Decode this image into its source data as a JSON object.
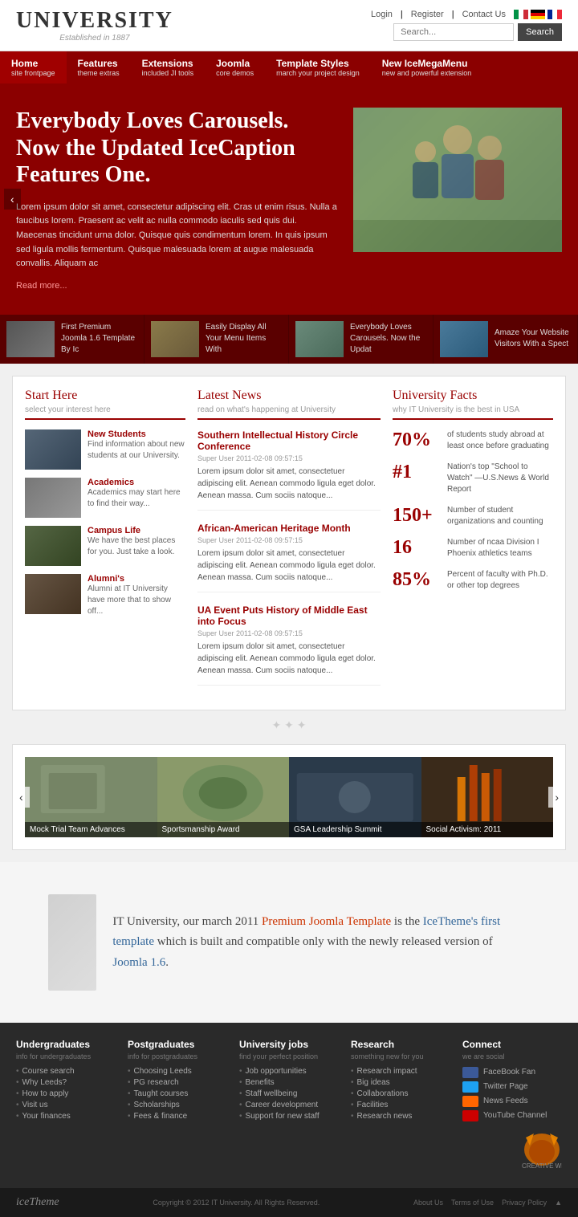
{
  "header": {
    "logo_title": "UNIVERSITY",
    "logo_sub": "Established in 1887",
    "links": [
      "Login",
      "Register",
      "Contact Us"
    ],
    "search_placeholder": "Search...",
    "search_btn": "Search"
  },
  "nav": {
    "items": [
      {
        "label": "Home",
        "sub": "site frontpage",
        "active": true
      },
      {
        "label": "Features",
        "sub": "theme extras",
        "active": false
      },
      {
        "label": "Extensions",
        "sub": "included JI tools",
        "active": false
      },
      {
        "label": "Joomla",
        "sub": "core demos",
        "active": false
      },
      {
        "label": "Template Styles",
        "sub": "march your project design",
        "active": false
      },
      {
        "label": "New IceMegaMenu",
        "sub": "new and powerful extension",
        "active": false
      }
    ]
  },
  "hero": {
    "title": "Everybody Loves Carousels. Now the Updated IceCaption Features One.",
    "body": "Lorem ipsum dolor sit amet, consectetur adipiscing elit. Cras ut enim risus. Nulla a faucibus lorem. Praesent ac velit ac nulla commodo iaculis sed quis dui. Maecenas tincidunt urna dolor. Quisque quis condimentum lorem. In quis ipsum sed ligula mollis fermentum. Quisque malesuada lorem at augue malesuada convallis. Aliquam ac",
    "read_more": "Read more..."
  },
  "carousel_thumbs": [
    {
      "text": "First Premium Joomla 1.6 Template By Ic"
    },
    {
      "text": "Easily Display All Your Menu Items With"
    },
    {
      "text": "Everybody Loves Carousels. Now the Updat"
    },
    {
      "text": "Amaze Your Website Visitors With a Spect"
    }
  ],
  "start_here": {
    "title": "Start Here",
    "subtitle": "select your interest here",
    "items": [
      {
        "label": "New Students",
        "desc": "Find information about new students at our University."
      },
      {
        "label": "Academics",
        "desc": "Academics may start here to find their way..."
      },
      {
        "label": "Campus Life",
        "desc": "We have the best places for you. Just take a look."
      },
      {
        "label": "Alumni's",
        "desc": "Alumni at IT University have more that to show off..."
      }
    ]
  },
  "latest_news": {
    "title": "Latest News",
    "subtitle": "read on what's happening at University",
    "items": [
      {
        "title": "Southern Intellectual History Circle Conference",
        "meta": "Super User    2011-02-08 09:57:15",
        "body": "Lorem ipsum dolor sit amet, consectetuer adipiscing elit. Aenean commodo ligula eget dolor. Aenean massa. Cum sociis natoque..."
      },
      {
        "title": "African-American Heritage Month",
        "meta": "Super User    2011-02-08 09:57:15",
        "body": "Lorem ipsum dolor sit amet, consectetuer adipiscing elit. Aenean commodo ligula eget dolor. Aenean massa. Cum sociis natoque..."
      },
      {
        "title": "UA Event Puts History of Middle East into Focus",
        "meta": "Super User    2011-02-08 09:57:15",
        "body": "Lorem ipsum dolor sit amet, consectetuer adipiscing elit. Aenean commodo ligula eget dolor. Aenean massa. Cum sociis natoque..."
      }
    ]
  },
  "university_facts": {
    "title": "University Facts",
    "subtitle": "why IT University is the best in USA",
    "items": [
      {
        "number": "70%",
        "text": "of students study abroad at least once before graduating"
      },
      {
        "number": "#1",
        "text": "Nation's top \"School to Watch\" —U.S.News & World Report"
      },
      {
        "number": "150+",
        "text": "Number of student organizations and counting"
      },
      {
        "number": "16",
        "text": "Number of ncaa Division I Phoenix athletics teams"
      },
      {
        "number": "85%",
        "text": "Percent of faculty with Ph.D. or other top degrees"
      }
    ]
  },
  "gallery": {
    "items": [
      {
        "label": "Mock Trial Team Advances"
      },
      {
        "label": "Sportsmanship Award"
      },
      {
        "label": "GSA Leadership Summit"
      },
      {
        "label": "Social Activism: 2011"
      }
    ]
  },
  "about": {
    "text_1": "IT University, our march 2011 ",
    "text_highlight1": "Premium Joomla Template",
    "text_2": " is the ",
    "text_highlight2": "IceTheme's first template",
    "text_3": " which is built and compatible only with the newly released version of ",
    "text_highlight3": "Joomla 1.6",
    "text_4": "."
  },
  "footer": {
    "cols": [
      {
        "title": "Undergraduates",
        "sub": "info for undergraduates",
        "links": [
          "Course search",
          "Why Leeds?",
          "How to apply",
          "Visit us",
          "Your finances"
        ]
      },
      {
        "title": "Postgraduates",
        "sub": "info for postgraduates",
        "links": [
          "Choosing Leeds",
          "PG research",
          "Taught courses",
          "Scholarships",
          "Fees & finance"
        ]
      },
      {
        "title": "University jobs",
        "sub": "find your perfect position",
        "links": [
          "Job opportunities",
          "Benefits",
          "Staff wellbeing",
          "Career development",
          "Support for new staff"
        ]
      },
      {
        "title": "Research",
        "sub": "something new for you",
        "links": [
          "Research impact",
          "Big ideas",
          "Collaborations",
          "Facilities",
          "Research news"
        ]
      },
      {
        "title": "Connect",
        "sub": "we are social",
        "social": [
          {
            "label": "FaceBook Fan",
            "type": "facebook"
          },
          {
            "label": "Twitter Page",
            "type": "twitter"
          },
          {
            "label": "News Feeds",
            "type": "rss"
          },
          {
            "label": "YouTube Channel",
            "type": "youtube"
          }
        ]
      }
    ],
    "bottom": {
      "logo": "iceTheme",
      "copy": "Copyright © 2012 IT University. All Rights Reserved.",
      "links": [
        "About Us",
        "Terms of Use",
        "Privacy Policy"
      ]
    }
  }
}
